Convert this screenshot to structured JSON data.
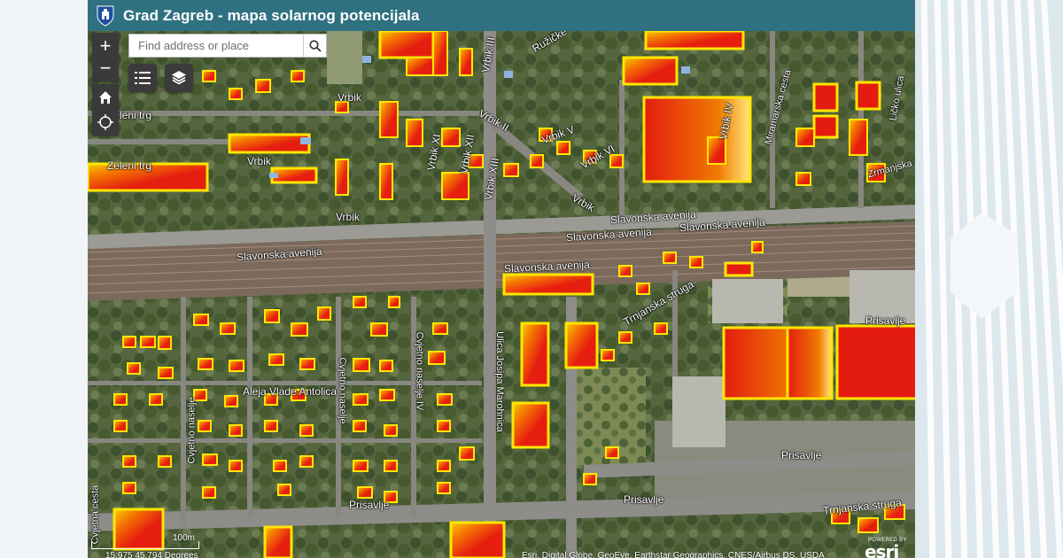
{
  "app": {
    "title": "Grad Zagreb - mapa solarnog potencijala"
  },
  "controls": {
    "zoom_in": "+",
    "zoom_out": "−",
    "search_placeholder": "Find address or place"
  },
  "street_labels": {
    "zeleni_trg_top": "Zeleni trg",
    "zeleni_trg_bottom": "Zeleni trg",
    "vrbik_1": "Vrbik",
    "vrbik_2": "Vrbik",
    "vrbik_3": "Vrbik",
    "vrbik_4": "Vrbik",
    "vrbik_iii": "Vrbik III",
    "vrbik_ii": "Vrbik II",
    "vrbik_v": "Vrbik V",
    "vrbik_vi": "Vrbik VI",
    "vrbik_xi": "Vrbik XI",
    "vrbik_xii": "Vrbik XII",
    "vrbik_xiii": "Vrbik XIII",
    "vrbik_iv": "Vrbik IV",
    "ruzicke": "Ružičke",
    "miramarska": "Miramarska cesta",
    "zrmanjska": "Zrmanjska",
    "lickoulica": "Ličko ulica",
    "slavonska_1": "Slavonska avenija",
    "slavonska_2": "Slavonska avenija",
    "slavonska_3": "Slavonska avenija",
    "slavonska_4": "Slavonska avenija",
    "slavonska_5": "Slavonska avenija",
    "trnjanska_1": "Trnjanska struga",
    "trnjanska_2": "Trnjanska struga",
    "prisavlje_1": "Prisavlje",
    "prisavlje_2": "Prisavlje",
    "prisavlje_3": "Prisavlje",
    "prisavlje_4": "Prisavlje",
    "aleja": "Aleja Vlade Antolica",
    "cvjetno_1": "Cvjetno naselje",
    "cvjetno_2": "Cvjetno naselje",
    "cvjetno_3": "Cvjetno naselje IV",
    "cvjetna": "Cvjetna cesta",
    "marohnica": "Ulica Josipa Marohnica"
  },
  "footer": {
    "scale_label": "100m",
    "coordinates": "15.975 45.794 Degrees",
    "attribution": "Esri, Digital Globe, GeoEye, Earthstar Geographics, CNES/Airbus DS, USDA",
    "esri_powered": "POWERED BY",
    "esri_mark": "esri"
  },
  "colors": {
    "header": "#2f7180",
    "roof_high": "#e81e10",
    "roof_low": "#ffe600"
  }
}
